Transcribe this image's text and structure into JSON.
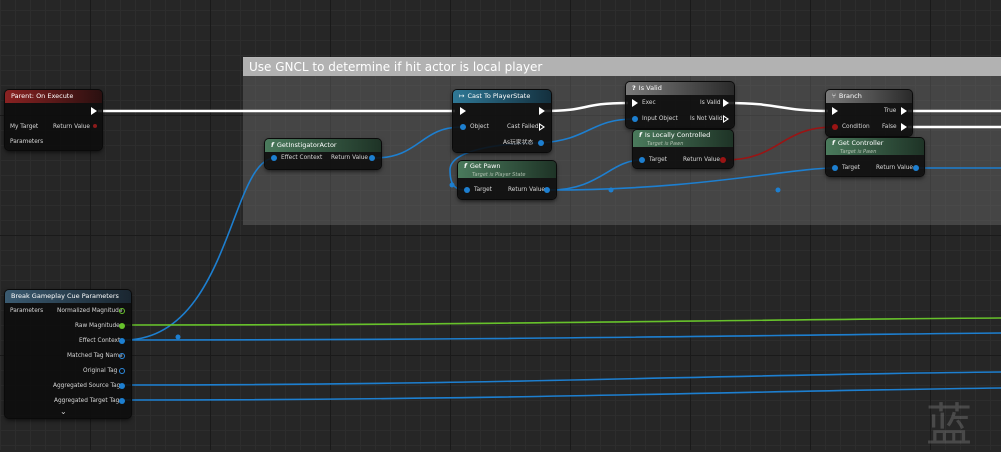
{
  "comment": {
    "title": "Use GNCL to determine if hit actor is local player"
  },
  "colors": {
    "exec_wire": "#ffffff",
    "object_wire": "#1d7fd0",
    "float_wire": "#67c22b",
    "bool_wire": "#9a1414",
    "pure_header": "#3f6d55",
    "cast_header": "#2e6b8f",
    "event_header": "#8a2222"
  },
  "nodes": {
    "parent_event": {
      "title": "Parent: On Execute",
      "pins": {
        "target": "My Target",
        "return": "Return Value",
        "params": "Parameters"
      }
    },
    "get_instigator": {
      "title": "GetInstigatorActor",
      "pins": {
        "effect_context": "Effect Context",
        "return": "Return Value"
      }
    },
    "cast": {
      "title": "Cast To PlayerState",
      "pins": {
        "object": "Object",
        "failed": "Cast Failed",
        "as": "As玩家状态"
      }
    },
    "get_pawn": {
      "title": "Get Pawn",
      "subtitle": "Target is Player State",
      "pins": {
        "target": "Target",
        "return": "Return Value"
      }
    },
    "is_valid": {
      "title": "Is Valid",
      "pins": {
        "exec": "Exec",
        "is_valid": "Is Valid",
        "input": "Input Object",
        "not_valid": "Is Not Valid"
      }
    },
    "is_locally": {
      "title": "Is Locally Controlled",
      "subtitle": "Target is Pawn",
      "pins": {
        "target": "Target",
        "return": "Return Value"
      }
    },
    "branch": {
      "title": "Branch",
      "pins": {
        "true": "True",
        "condition": "Condition",
        "false": "False"
      }
    },
    "get_controller": {
      "title": "Get Controller",
      "subtitle": "Target is Pawn",
      "pins": {
        "target": "Target",
        "return": "Return Value"
      }
    },
    "break_params": {
      "title": "Break Gameplay Cue Parameters",
      "pins": {
        "params": "Parameters",
        "normalized": "Normalized Magnitude",
        "raw": "Raw Magnitude",
        "effect_context": "Effect Context",
        "matched_tag": "Matched Tag Name",
        "original_tag": "Original Tag",
        "source_tags": "Aggregated Source Tags",
        "target_tags": "Aggregated Target Tags"
      }
    }
  },
  "watermark": "蓝"
}
